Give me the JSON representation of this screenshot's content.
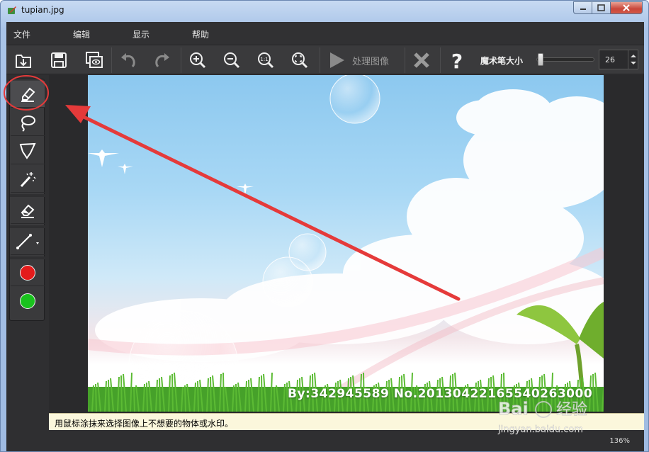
{
  "window": {
    "title": "tupian.jpg"
  },
  "menu": {
    "items": [
      "文件",
      "编辑",
      "显示",
      "帮助"
    ]
  },
  "toolbar": {
    "buttons": [
      "open-icon",
      "save-icon",
      "save-as-icon",
      "undo-icon",
      "redo-icon",
      "zoom-in-icon",
      "zoom-out-icon",
      "actual-size-icon",
      "fit-window-icon"
    ],
    "process_label": "处理图像",
    "brush_size_label": "魔术笔大小",
    "brush_size_value": "26",
    "brush_size_fraction": 0.05
  },
  "tools": {
    "items": [
      "marker-icon",
      "lasso-icon",
      "polygon-lasso-icon",
      "magic-wand-icon",
      "eraser-icon",
      "line-icon"
    ],
    "colors": {
      "red": "#e41b1b",
      "green": "#19c21d"
    }
  },
  "canvas": {
    "watermark_text": "By:342945589  No.20130422165540263000"
  },
  "hint": {
    "text": "用鼠标涂抹来选择图像上不想要的物体或水印。"
  },
  "status": {
    "zoom": "136%"
  },
  "site_watermark": {
    "text": "Bai经验",
    "url": "jingyan.baidu.com"
  },
  "colors": {
    "annotation": "#e53a3a",
    "panel": "#3a3a3c"
  }
}
